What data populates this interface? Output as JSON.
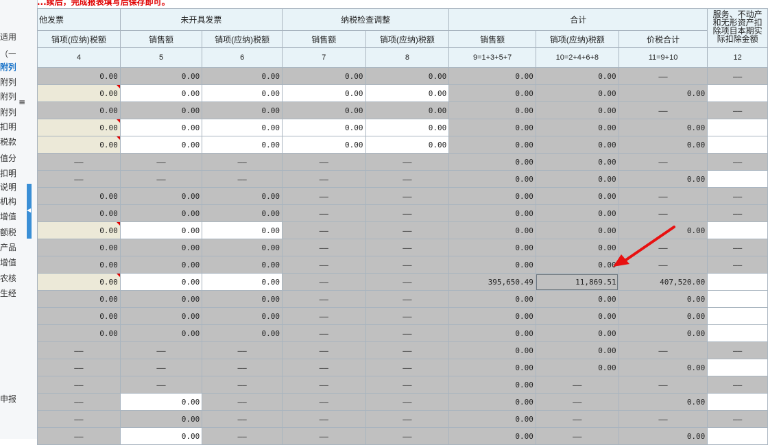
{
  "banner": "...续后，完成报表填写后保存即可。",
  "sidebar": {
    "items": [
      {
        "label": "适用",
        "active": false
      },
      {
        "label": "（一",
        "active": false
      },
      {
        "label": "附列",
        "active": true
      },
      {
        "label": "附列",
        "active": false
      },
      {
        "label": "附列资",
        "active": false
      },
      {
        "label": "附列资",
        "active": false
      },
      {
        "label": "扣明细表",
        "active": false
      },
      {
        "label": "税款抵",
        "active": false
      },
      {
        "label": "值分配",
        "active": false
      },
      {
        "label": "扣明细表",
        "active": false
      },
      {
        "label": "说明细",
        "active": false
      },
      {
        "label": "机构增",
        "active": false
      },
      {
        "label": "增值税",
        "active": false
      },
      {
        "label": "额税进",
        "active": false
      },
      {
        "label": "产品增",
        "active": false
      },
      {
        "label": "增值税",
        "active": false
      },
      {
        "label": "农核定",
        "active": false
      },
      {
        "label": "生经营",
        "active": false
      },
      {
        "label": "申报",
        "active": false
      }
    ],
    "scroll_glyph": "≡",
    "collapse_glyph": "◀"
  },
  "table": {
    "groups": [
      "他发票",
      "未开具发票",
      "纳税检查调整",
      "合计",
      "服务、不动产和无形资产扣除项目本期实际扣除金额"
    ],
    "subheaders": [
      "销项(应纳)税额",
      "销售额",
      "销项(应纳)税额",
      "销售额",
      "销项(应纳)税额",
      "销售额",
      "销项(应纳)税额",
      "价税合计",
      ""
    ],
    "colnums": [
      "4",
      "5",
      "6",
      "7",
      "8",
      "9=1+3+5+7",
      "10=2+4+6+8",
      "11=9+10",
      "12"
    ],
    "rows": [
      [
        [
          "0.00",
          "g"
        ],
        [
          "0.00",
          "g"
        ],
        [
          "0.00",
          "g"
        ],
        [
          "0.00",
          "g"
        ],
        [
          "0.00",
          "g"
        ],
        [
          "0.00",
          "g"
        ],
        [
          "0.00",
          "g"
        ],
        [
          "——",
          "g"
        ],
        [
          "——",
          "g"
        ]
      ],
      [
        [
          "0.00",
          "y"
        ],
        [
          "0.00",
          "w"
        ],
        [
          "0.00",
          "w"
        ],
        [
          "0.00",
          "w"
        ],
        [
          "0.00",
          "w"
        ],
        [
          "0.00",
          "g"
        ],
        [
          "0.00",
          "g"
        ],
        [
          "0.00",
          "g"
        ],
        [
          "",
          "w"
        ]
      ],
      [
        [
          "0.00",
          "g"
        ],
        [
          "0.00",
          "g"
        ],
        [
          "0.00",
          "g"
        ],
        [
          "0.00",
          "g"
        ],
        [
          "0.00",
          "g"
        ],
        [
          "0.00",
          "g"
        ],
        [
          "0.00",
          "g"
        ],
        [
          "——",
          "g"
        ],
        [
          "——",
          "g"
        ]
      ],
      [
        [
          "0.00",
          "y"
        ],
        [
          "0.00",
          "w"
        ],
        [
          "0.00",
          "w"
        ],
        [
          "0.00",
          "w"
        ],
        [
          "0.00",
          "w"
        ],
        [
          "0.00",
          "g"
        ],
        [
          "0.00",
          "g"
        ],
        [
          "0.00",
          "g"
        ],
        [
          "",
          "w"
        ]
      ],
      [
        [
          "0.00",
          "y"
        ],
        [
          "0.00",
          "w"
        ],
        [
          "0.00",
          "w"
        ],
        [
          "0.00",
          "w"
        ],
        [
          "0.00",
          "w"
        ],
        [
          "0.00",
          "g"
        ],
        [
          "0.00",
          "g"
        ],
        [
          "0.00",
          "g"
        ],
        [
          "",
          "w"
        ]
      ],
      [
        [
          "——",
          "g"
        ],
        [
          "——",
          "g"
        ],
        [
          "——",
          "g"
        ],
        [
          "——",
          "g"
        ],
        [
          "——",
          "g"
        ],
        [
          "0.00",
          "g"
        ],
        [
          "0.00",
          "g"
        ],
        [
          "——",
          "g"
        ],
        [
          "——",
          "g"
        ]
      ],
      [
        [
          "——",
          "g"
        ],
        [
          "——",
          "g"
        ],
        [
          "——",
          "g"
        ],
        [
          "——",
          "g"
        ],
        [
          "——",
          "g"
        ],
        [
          "0.00",
          "g"
        ],
        [
          "0.00",
          "g"
        ],
        [
          "0.00",
          "g"
        ],
        [
          "",
          "w"
        ]
      ],
      [
        [
          "0.00",
          "g"
        ],
        [
          "0.00",
          "g"
        ],
        [
          "0.00",
          "g"
        ],
        [
          "——",
          "g"
        ],
        [
          "——",
          "g"
        ],
        [
          "0.00",
          "g"
        ],
        [
          "0.00",
          "g"
        ],
        [
          "——",
          "g"
        ],
        [
          "——",
          "g"
        ]
      ],
      [
        [
          "0.00",
          "g"
        ],
        [
          "0.00",
          "g"
        ],
        [
          "0.00",
          "g"
        ],
        [
          "——",
          "g"
        ],
        [
          "——",
          "g"
        ],
        [
          "0.00",
          "g"
        ],
        [
          "0.00",
          "g"
        ],
        [
          "——",
          "g"
        ],
        [
          "——",
          "g"
        ]
      ],
      [
        [
          "0.00",
          "y"
        ],
        [
          "0.00",
          "w"
        ],
        [
          "0.00",
          "w"
        ],
        [
          "——",
          "g"
        ],
        [
          "——",
          "g"
        ],
        [
          "0.00",
          "g"
        ],
        [
          "0.00",
          "g"
        ],
        [
          "0.00",
          "g"
        ],
        [
          "",
          "w"
        ]
      ],
      [
        [
          "0.00",
          "g"
        ],
        [
          "0.00",
          "g"
        ],
        [
          "0.00",
          "g"
        ],
        [
          "——",
          "g"
        ],
        [
          "——",
          "g"
        ],
        [
          "0.00",
          "g"
        ],
        [
          "0.00",
          "g"
        ],
        [
          "——",
          "g"
        ],
        [
          "——",
          "g"
        ]
      ],
      [
        [
          "0.00",
          "g"
        ],
        [
          "0.00",
          "g"
        ],
        [
          "0.00",
          "g"
        ],
        [
          "——",
          "g"
        ],
        [
          "——",
          "g"
        ],
        [
          "0.00",
          "g"
        ],
        [
          "0.00",
          "g"
        ],
        [
          "——",
          "g"
        ],
        [
          "——",
          "g"
        ]
      ],
      [
        [
          "0.00",
          "y"
        ],
        [
          "0.00",
          "w"
        ],
        [
          "0.00",
          "w"
        ],
        [
          "——",
          "g"
        ],
        [
          "——",
          "g"
        ],
        [
          "395,650.49",
          "g"
        ],
        [
          "11,869.51",
          "g"
        ],
        [
          "407,520.00",
          "g"
        ],
        [
          "",
          "w"
        ]
      ],
      [
        [
          "0.00",
          "g"
        ],
        [
          "0.00",
          "g"
        ],
        [
          "0.00",
          "g"
        ],
        [
          "——",
          "g"
        ],
        [
          "——",
          "g"
        ],
        [
          "0.00",
          "g"
        ],
        [
          "0.00",
          "g"
        ],
        [
          "0.00",
          "g"
        ],
        [
          "",
          "w"
        ]
      ],
      [
        [
          "0.00",
          "g"
        ],
        [
          "0.00",
          "g"
        ],
        [
          "0.00",
          "g"
        ],
        [
          "——",
          "g"
        ],
        [
          "——",
          "g"
        ],
        [
          "0.00",
          "g"
        ],
        [
          "0.00",
          "g"
        ],
        [
          "0.00",
          "g"
        ],
        [
          "",
          "w"
        ]
      ],
      [
        [
          "0.00",
          "g"
        ],
        [
          "0.00",
          "g"
        ],
        [
          "0.00",
          "g"
        ],
        [
          "——",
          "g"
        ],
        [
          "——",
          "g"
        ],
        [
          "0.00",
          "g"
        ],
        [
          "0.00",
          "g"
        ],
        [
          "0.00",
          "g"
        ],
        [
          "",
          "w"
        ]
      ],
      [
        [
          "——",
          "g"
        ],
        [
          "——",
          "g"
        ],
        [
          "——",
          "g"
        ],
        [
          "——",
          "g"
        ],
        [
          "——",
          "g"
        ],
        [
          "0.00",
          "g"
        ],
        [
          "0.00",
          "g"
        ],
        [
          "——",
          "g"
        ],
        [
          "——",
          "g"
        ]
      ],
      [
        [
          "——",
          "g"
        ],
        [
          "——",
          "g"
        ],
        [
          "——",
          "g"
        ],
        [
          "——",
          "g"
        ],
        [
          "——",
          "g"
        ],
        [
          "0.00",
          "g"
        ],
        [
          "0.00",
          "g"
        ],
        [
          "0.00",
          "g"
        ],
        [
          "",
          "w"
        ]
      ],
      [
        [
          "——",
          "g"
        ],
        [
          "——",
          "g"
        ],
        [
          "——",
          "g"
        ],
        [
          "——",
          "g"
        ],
        [
          "——",
          "g"
        ],
        [
          "0.00",
          "g"
        ],
        [
          "——",
          "g"
        ],
        [
          "——",
          "g"
        ],
        [
          "——",
          "g"
        ]
      ],
      [
        [
          "——",
          "g"
        ],
        [
          "0.00",
          "w"
        ],
        [
          "——",
          "g"
        ],
        [
          "——",
          "g"
        ],
        [
          "——",
          "g"
        ],
        [
          "0.00",
          "g"
        ],
        [
          "——",
          "g"
        ],
        [
          "0.00",
          "g"
        ],
        [
          "",
          "w"
        ]
      ],
      [
        [
          "——",
          "g"
        ],
        [
          "0.00",
          "g"
        ],
        [
          "——",
          "g"
        ],
        [
          "——",
          "g"
        ],
        [
          "——",
          "g"
        ],
        [
          "0.00",
          "g"
        ],
        [
          "——",
          "g"
        ],
        [
          "——",
          "g"
        ],
        [
          "——",
          "g"
        ]
      ],
      [
        [
          "——",
          "g"
        ],
        [
          "0.00",
          "w"
        ],
        [
          "——",
          "g"
        ],
        [
          "——",
          "g"
        ],
        [
          "——",
          "g"
        ],
        [
          "0.00",
          "g"
        ],
        [
          "——",
          "g"
        ],
        [
          "0.00",
          "g"
        ],
        [
          "",
          "w"
        ]
      ]
    ]
  },
  "colors": {
    "header_bg": "#e8f3f8",
    "readonly": "#c0c0c0",
    "editable": "#ffffff",
    "prefilled": "#ece9d8",
    "marker": "#e00000",
    "arrow": "#e81010",
    "nav_active": "#1a73c8"
  }
}
